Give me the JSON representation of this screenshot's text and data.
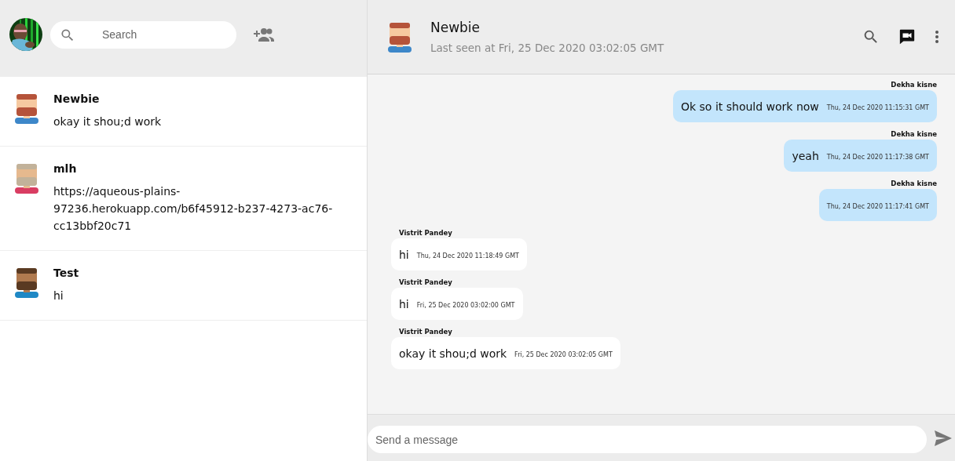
{
  "sidebar": {
    "search": {
      "placeholder": "Search"
    },
    "chats": [
      {
        "name": "Newbie",
        "last_message": "okay it shou;d work"
      },
      {
        "name": "mlh",
        "last_message": "https://aqueous-plains-97236.herokuapp.com/b6f45912-b237-4273-ac76-cc13bbf20c71"
      },
      {
        "name": "Test",
        "last_message": "hi"
      }
    ]
  },
  "chat": {
    "name": "Newbie",
    "last_seen": "Last seen at Fri, 25 Dec 2020 03:02:05 GMT",
    "messages": [
      {
        "kind": "sent",
        "sender": "Dekha kisne",
        "text": "Ok so it should work now",
        "time": "Thu, 24 Dec 2020 11:15:31 GMT"
      },
      {
        "kind": "sent",
        "sender": "Dekha kisne",
        "text": "yeah",
        "time": "Thu, 24 Dec 2020 11:17:38 GMT"
      },
      {
        "kind": "sent",
        "sender": "Dekha kisne",
        "time": "Thu, 24 Dec 2020 11:17:41 GMT"
      },
      {
        "kind": "received",
        "sender": "Vistrit Pandey",
        "text": "hi",
        "time": "Thu, 24 Dec 2020 11:18:49 GMT"
      },
      {
        "kind": "received",
        "sender": "Vistrit Pandey",
        "text": "hi",
        "time": "Fri, 25 Dec 2020 03:02:00 GMT"
      },
      {
        "kind": "received",
        "sender": "Vistrit Pandey",
        "text": "okay it shou;d work",
        "time": "Fri, 25 Dec 2020 03:02:05 GMT"
      }
    ],
    "composer": {
      "placeholder": "Send a message"
    }
  }
}
